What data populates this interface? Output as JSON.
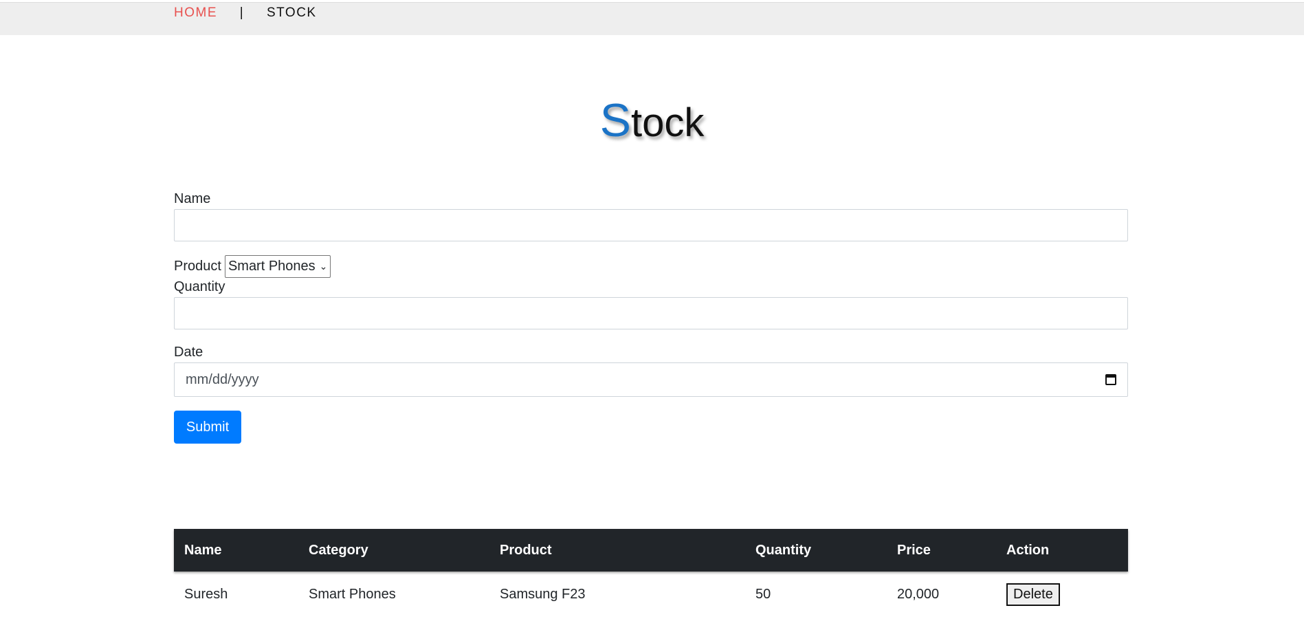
{
  "nav": {
    "home_label": "HOME",
    "separator": "|",
    "stock_label": "STOCK"
  },
  "page_title": {
    "first_letter": "S",
    "rest": "tock"
  },
  "form": {
    "name_label": "Name",
    "name_value": "",
    "product_label": "Product",
    "product_selected": "Smart Phones",
    "quantity_label": "Quantity",
    "quantity_value": "",
    "date_label": "Date",
    "date_placeholder": "mm/dd/yyyy",
    "submit_label": "Submit"
  },
  "table": {
    "headers": [
      "Name",
      "Category",
      "Product",
      "Quantity",
      "Price",
      "Action"
    ],
    "rows": [
      {
        "name": "Suresh",
        "category": "Smart Phones",
        "product": "Samsung F23",
        "quantity": "50",
        "price": "20,000",
        "action_label": "Delete"
      }
    ]
  },
  "colors": {
    "nav_home": "#e8514f",
    "title_accent": "#1b73c6",
    "submit_button": "#007bff",
    "table_header": "#212529"
  }
}
